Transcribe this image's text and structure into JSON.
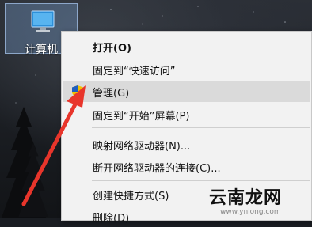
{
  "desktop": {
    "icon_label": "计算机"
  },
  "context_menu": {
    "items": [
      {
        "label": "打开(O)"
      },
      {
        "label": "固定到“快速访问”"
      },
      {
        "label": "管理(G)"
      },
      {
        "label": "固定到“开始”屏幕(P)"
      },
      {
        "label": "映射网络驱动器(N)..."
      },
      {
        "label": "断开网络驱动器的连接(C)..."
      },
      {
        "label": "创建快捷方式(S)"
      },
      {
        "label": "删除(D)"
      }
    ]
  },
  "watermark": {
    "text": "云南龙网",
    "small_text": "www.ynlong.com"
  }
}
